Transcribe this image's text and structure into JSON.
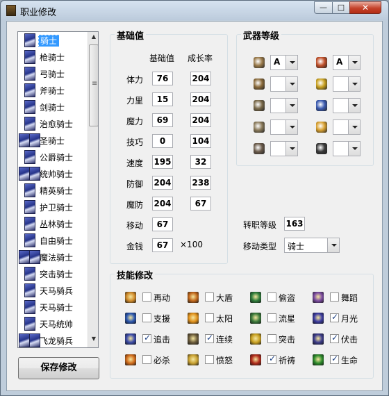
{
  "window": {
    "title": "职业修改"
  },
  "class_list": {
    "items": [
      "骑士",
      "枪骑士",
      "弓骑士",
      "斧骑士",
      "剑骑士",
      "治愈骑士",
      "圣骑士",
      "公爵骑士",
      "统帅骑士",
      "精英骑士",
      "护卫骑士",
      "丛林骑士",
      "自由骑士",
      "魔法骑士",
      "突击骑士",
      "天马骑兵",
      "天马骑士",
      "天马统帅",
      "飞龙骑兵"
    ],
    "selected": "骑士"
  },
  "save_button": "保存修改",
  "base_stats": {
    "title": "基础值",
    "col_base": "基础值",
    "col_growth": "成长率",
    "rows": [
      {
        "label": "体力",
        "base": "76",
        "growth": "204"
      },
      {
        "label": "力里",
        "base": "15",
        "growth": "204"
      },
      {
        "label": "魔力",
        "base": "69",
        "growth": "204"
      },
      {
        "label": "技巧",
        "base": "0",
        "growth": "104"
      },
      {
        "label": "速度",
        "base": "195",
        "growth": "32"
      },
      {
        "label": "防御",
        "base": "204",
        "growth": "238"
      },
      {
        "label": "魔防",
        "base": "204",
        "growth": "67"
      },
      {
        "label": "移动",
        "base": "67"
      },
      {
        "label": "金钱",
        "base": "67"
      }
    ],
    "money_suffix": "×100"
  },
  "weapon_rank": {
    "title": "武器等级",
    "weapons": [
      {
        "icon": "sword-icon",
        "value": "A"
      },
      {
        "icon": "fire-magic-icon",
        "value": "A"
      },
      {
        "icon": "lance-icon",
        "value": ""
      },
      {
        "icon": "thunder-magic-icon",
        "value": ""
      },
      {
        "icon": "axe-icon",
        "value": ""
      },
      {
        "icon": "wind-magic-icon",
        "value": ""
      },
      {
        "icon": "bow-icon",
        "value": ""
      },
      {
        "icon": "light-magic-icon",
        "value": ""
      },
      {
        "icon": "knife-icon",
        "value": ""
      },
      {
        "icon": "dark-magic-icon",
        "value": ""
      }
    ]
  },
  "promotion": {
    "label": "转职等级",
    "value": "163"
  },
  "move_type": {
    "label": "移动类型",
    "value": "骑士"
  },
  "skills": {
    "title": "技能修改",
    "items": [
      {
        "label": "再动",
        "checked": false,
        "color": "#d08a2a"
      },
      {
        "label": "大盾",
        "checked": false,
        "color": "#c0661a"
      },
      {
        "label": "偷盗",
        "checked": false,
        "color": "#2e7d3a"
      },
      {
        "label": "舞蹈",
        "checked": false,
        "color": "#7a4aa0"
      },
      {
        "label": "支援",
        "checked": false,
        "color": "#2a56b0"
      },
      {
        "label": "太阳",
        "checked": false,
        "color": "#e0901a"
      },
      {
        "label": "流星",
        "checked": false,
        "color": "#3a7a3a"
      },
      {
        "label": "月光",
        "checked": true,
        "color": "#3a3aa0"
      },
      {
        "label": "追击",
        "checked": true,
        "color": "#3a4aa8"
      },
      {
        "label": "连续",
        "checked": true,
        "color": "#6a5a3a"
      },
      {
        "label": "突击",
        "checked": false,
        "color": "#c8a020"
      },
      {
        "label": "伏击",
        "checked": true,
        "color": "#3a3a8a"
      },
      {
        "label": "必杀",
        "checked": false,
        "color": "#d06a1a"
      },
      {
        "label": "愤怒",
        "checked": false,
        "color": "#c8a030"
      },
      {
        "label": "祈祷",
        "checked": true,
        "color": "#b02a1a"
      },
      {
        "label": "生命",
        "checked": true,
        "color": "#2a8a2a"
      }
    ]
  }
}
